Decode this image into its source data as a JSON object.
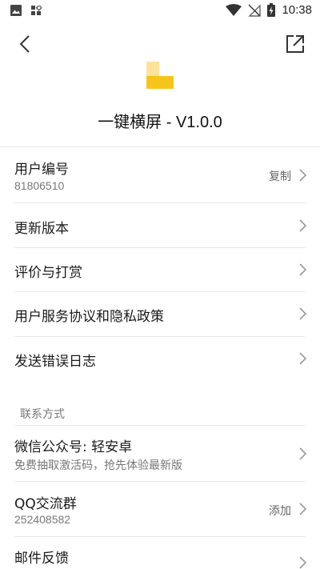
{
  "status_bar": {
    "time": "10:38",
    "left_icons": [
      "image-icon",
      "app-grid-icon"
    ],
    "right_icons": [
      "wifi-icon",
      "no-sim-icon",
      "battery-charging-icon"
    ]
  },
  "header": {
    "back_icon": "chevron-left-icon",
    "share_icon": "open-external-icon",
    "app_title": "一键横屏 - V1.0.0",
    "logo_colors": {
      "top": "#fbe39a",
      "bottom": "#f7c41c"
    }
  },
  "list": {
    "user_id": {
      "label": "用户编号",
      "value": "81806510",
      "action": "复制"
    },
    "update": {
      "label": "更新版本"
    },
    "rate": {
      "label": "评价与打赏"
    },
    "agreement": {
      "label": "用户服务协议和隐私政策"
    },
    "error_log": {
      "label": "发送错误日志"
    }
  },
  "contact": {
    "section_title": "联系方式",
    "wechat": {
      "label": "微信公众号: 轻安卓",
      "sub": "免费抽取激活码，抢先体验最新版"
    },
    "qq": {
      "label": "QQ交流群",
      "value": "252408582",
      "action": "添加"
    },
    "email": {
      "label": "邮件反馈"
    }
  }
}
